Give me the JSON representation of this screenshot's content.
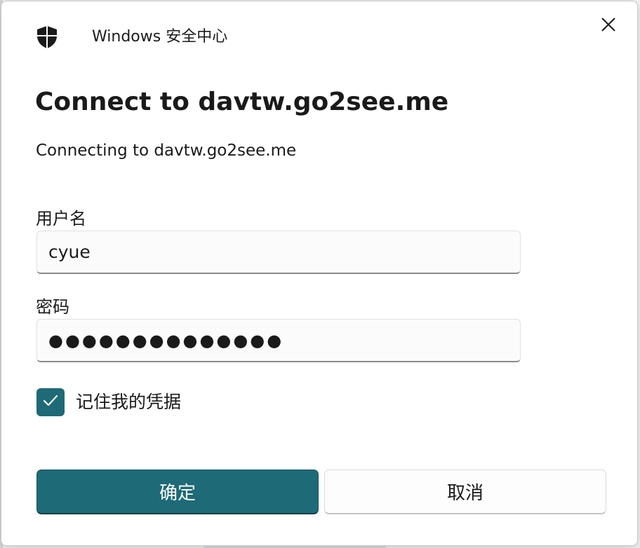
{
  "window": {
    "app_title": "Windows 安全中心",
    "icon": "shield-icon",
    "close_icon": "close-icon"
  },
  "dialog": {
    "heading": "Connect to davtw.go2see.me",
    "message": "Connecting to davtw.go2see.me"
  },
  "form": {
    "username_label": "用户名",
    "username_value": "cyue",
    "password_label": "密码",
    "password_value": "●●●●●●●●●●●●●●",
    "remember_label": "记住我的凭据",
    "remember_checked": true
  },
  "buttons": {
    "ok_label": "确定",
    "cancel_label": "取消"
  },
  "colors": {
    "accent": "#1e6a76",
    "background": "#ffffff",
    "text": "#1a1a1a"
  }
}
